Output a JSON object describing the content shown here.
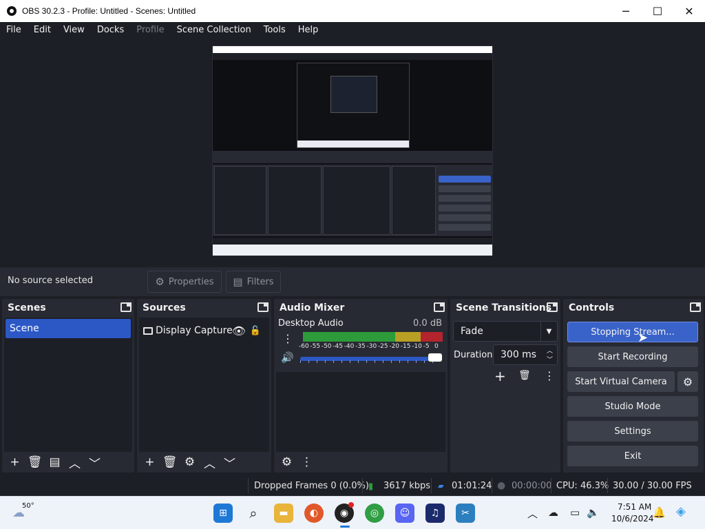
{
  "window": {
    "title": "OBS 30.2.3 - Profile: Untitled - Scenes: Untitled",
    "minimize_glyph": "─",
    "maximize_glyph": "☐",
    "close_glyph": "✕"
  },
  "menu": {
    "items": [
      "File",
      "Edit",
      "View",
      "Docks",
      "Profile",
      "Scene Collection",
      "Tools",
      "Help"
    ],
    "disabled": [
      "Profile"
    ]
  },
  "source_toolbar": {
    "no_source": "No source selected",
    "properties_label": "Properties",
    "filters_label": "Filters"
  },
  "scenes": {
    "title": "Scenes",
    "items": [
      "Scene"
    ],
    "selected": "Scene"
  },
  "sources": {
    "title": "Sources",
    "items": [
      {
        "label": "Display Capture",
        "visible": true,
        "locked": false
      }
    ]
  },
  "audio_mixer": {
    "title": "Audio Mixer",
    "channels": [
      {
        "name": "Desktop Audio",
        "level_db": "0.0 dB",
        "volume_fraction": 1.0,
        "scale_labels": [
          "-60",
          "-55",
          "-50",
          "-45",
          "-40",
          "-35",
          "-30",
          "-25",
          "-20",
          "-15",
          "-10",
          "-5",
          "0"
        ]
      }
    ]
  },
  "transitions": {
    "title": "Scene Transitions",
    "selected": "Fade",
    "duration_label": "Duration",
    "duration_value": "300 ms"
  },
  "controls": {
    "title": "Controls",
    "stream_button": "Stopping Stream...",
    "record_button": "Start Recording",
    "virtual_camera_button": "Start Virtual Camera",
    "studio_mode_button": "Studio Mode",
    "settings_button": "Settings",
    "exit_button": "Exit"
  },
  "status_bar": {
    "dropped_frames": "Dropped Frames 0 (0.0%)",
    "bitrate": "3617 kbps",
    "stream_time": "01:01:24",
    "record_time": "00:00:00",
    "cpu": "CPU: 46.3%",
    "fps": "30.00 / 30.00 FPS"
  },
  "taskbar": {
    "weather_temp": "50°",
    "time": "7:51 AM",
    "date": "10/6/2024",
    "apps": [
      "start-icon",
      "search-icon",
      "file-explorer-icon",
      "firefox-icon",
      "obs-icon",
      "chrome-icon",
      "discord-icon",
      "audacity-icon",
      "kdenlive-icon"
    ]
  },
  "colors": {
    "accent_blue": "#2c58c6",
    "dock_bg": "#272a33",
    "panel_bg": "#1d1f26",
    "meter_green": "#2e9b3a",
    "meter_yellow": "#b9a024",
    "meter_red": "#b4242c"
  }
}
